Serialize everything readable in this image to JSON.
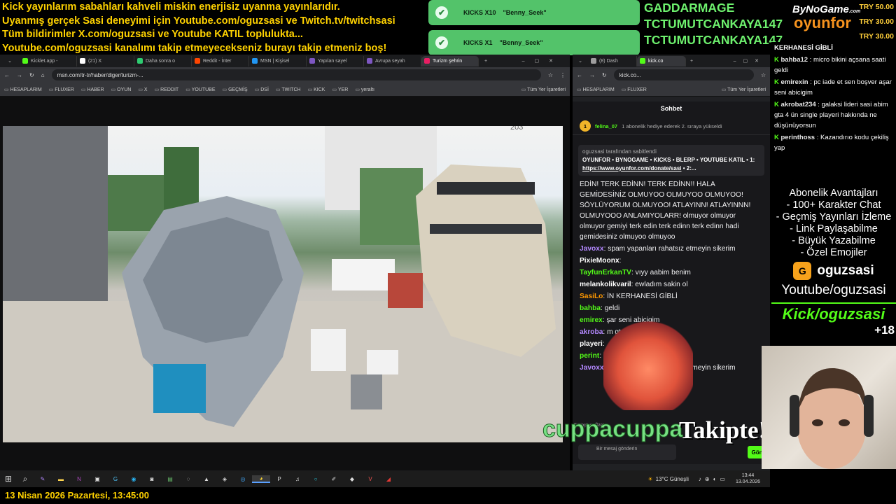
{
  "top_overlay": {
    "lines": [
      "Kick yayınlarım sabahları kahveli miskin enerjisiz uyanma yayınlarıdır.",
      "Uyanmış gerçek Sasi deneyimi için Youtube.com/oguzsasi ve Twitch.tv/twitchsasi",
      "Tüm bildirimler X.com/oguzsasi ve Youtube KATIL toplulukta...",
      "Youtube.com/oguzsasi kanalımı takip etmeyecekseniz burayı takip etmeniz boş!"
    ]
  },
  "alerts": [
    {
      "badge": "KICKS X10",
      "user": "\"Benny_Seek\""
    },
    {
      "badge": "KICKS X1",
      "user": "\"Benny_Seek\""
    }
  ],
  "supporters": [
    "GADDARMAGE",
    "TCTUMUTCANKAYA147",
    "TCTUMUTCANKAYA147"
  ],
  "brand": {
    "line1": "ByNoGame",
    "sub": ".com",
    "line2": "oyunfor"
  },
  "donations": [
    "TRY 50.00",
    "TRY 30.00",
    "TRY 30.00"
  ],
  "left_browser": {
    "tabs": [
      "Kicklet.app -",
      "(21) X",
      "Daha sonra o",
      "Reddit - İnter",
      "MSN | Kişisel",
      "Yapılan sayel",
      "Avrupa seyah",
      "Turizm şehrin"
    ],
    "url": "msn.com/tr-tr/haber/diger/turizm-...",
    "bookmarks": [
      "HESAPLARIM",
      "FLUXER",
      "HABER",
      "OYUN",
      "X",
      "REDDIT",
      "YOUTUBE",
      "GEÇMİŞ",
      "DSİ",
      "TWITCH",
      "KICK",
      "YER",
      "yeraltı"
    ],
    "other_bookmarks": "Tüm Yer İşaretleri"
  },
  "right_browser": {
    "tabs": [
      "(8) Dash",
      "kick.co"
    ],
    "url": "kick.co...",
    "bookmarks": [
      "HESAPLARIM",
      "FLUXER"
    ],
    "other_bookmarks": "Tüm Yer İşaretleri"
  },
  "chat": {
    "title": "Sohbet",
    "gift": {
      "user": "felina_07",
      "text": "1 abonelik hediye ederek 2. sıraya yükseldi",
      "count": "1"
    },
    "pinned_by": "oguzsasi tarafından sabitlendi",
    "pinned_text": "OYUNFOR • BYNOGAME • KICKS • BLERP • YOUTUBE KATIL • 1:",
    "pinned_link": "https://www.oyunfor.com/donate/sasi",
    "pinned_tail": "• 2:...",
    "long_msg": "EDİN! TERK EDİNN! TERK EDİNN!! HALA GEMİDESİNİZ OLMUYOO OLMUYOO OLMUYOO! SÖYLÜYORUM OLMUYOO! ATLAYINN! ATLAYINNN! OLMUYOOO ANLAMIYOLARR! olmuyor olmuyor olmuyor gemiyi terk edin terk edinn terk edinn hadi gemidesiniz olmuyoo olmuyoo",
    "messages": [
      {
        "user": "Javoxx",
        "text": "spam yapanları rahatsız etmeyin sikerim",
        "color": "#b388ff"
      },
      {
        "user": "PixieMoonx",
        "text": "",
        "color": "#ffffff"
      },
      {
        "user": "TayfunErkanTV",
        "text": "vıyy aabim benim",
        "color": "#53fc18"
      },
      {
        "user": "melankolikvaril",
        "text": "ewladım sakin ol",
        "color": "#ffffff"
      },
      {
        "user": "SasiLo",
        "text": "İN KERHANESİ GİBLİ",
        "color": "#ff9800"
      },
      {
        "user": "bahba",
        "text": "geldi",
        "color": "#53fc18"
      },
      {
        "user": "emirex",
        "text": "şar seni abicigim",
        "color": "#53fc18"
      },
      {
        "user": "akroba",
        "text": "m gta 4 ün single",
        "color": "#b388ff"
      },
      {
        "user": "playeri",
        "text": "",
        "color": "#ffffff"
      },
      {
        "user": "perint",
        "text": "iş yap",
        "color": "#53fc18"
      },
      {
        "user": "Javoxx",
        "text": "spam yapanları rahatsız etmeyin sikerim",
        "color": "#b388ff"
      }
    ],
    "input_placeholder": "Bir mesaj gönderin",
    "send": "Gönd",
    "followers_label": "Takipçilere Özel"
  },
  "follow_alert": {
    "user": "cuppacuppa",
    "text": "Takipte!"
  },
  "right_overlay": {
    "chat": [
      {
        "user": "",
        "text": "KERHANESİ GİBLİ"
      },
      {
        "user": "bahba12",
        "text": "micro bikini açsana saati geldi"
      },
      {
        "user": "emirexin",
        "text": "pc iade et sen boşver aşar seni abicigim"
      },
      {
        "user": "akrobat234",
        "text": "galaksi lideri sasi abim gta 4 ün single playeri hakkında ne düşünüyorsun"
      },
      {
        "user": "perinthoss",
        "text": "Kazandırıo kodu çekiliş yap"
      }
    ],
    "perks": [
      "Abonelik Avantajları",
      "- 100+ Karakter Chat",
      "- Geçmiş Yayınları İzleme",
      "- Link Paylaşabilme",
      "- Büyük Yazabilme",
      "- Özel Emojiler"
    ],
    "handle": "oguzsasi",
    "youtube": "Youtube/oguzsasi",
    "kick": "Kick/oguzsasi",
    "age": "+18"
  },
  "taskbar": {
    "weather": "13°C  Güneşli",
    "time": "13:44",
    "date": "13.04.2026"
  },
  "bottom": {
    "datetime": "13 Nisan 2026 Pazartesi, 13:45:00"
  },
  "photo": {
    "sign": "203"
  }
}
